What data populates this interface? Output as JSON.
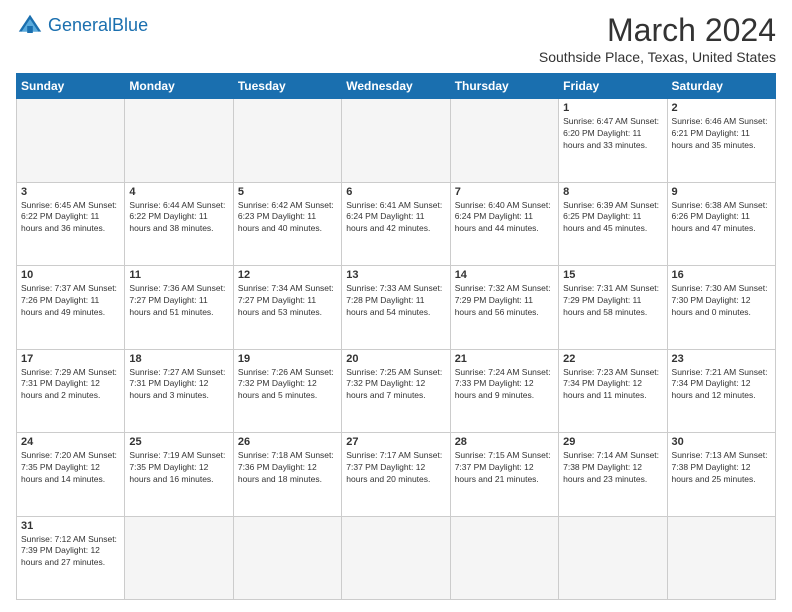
{
  "header": {
    "logo_general": "General",
    "logo_blue": "Blue",
    "month_title": "March 2024",
    "subtitle": "Southside Place, Texas, United States"
  },
  "days_of_week": [
    "Sunday",
    "Monday",
    "Tuesday",
    "Wednesday",
    "Thursday",
    "Friday",
    "Saturday"
  ],
  "weeks": [
    [
      {
        "day": "",
        "empty": true
      },
      {
        "day": "",
        "empty": true
      },
      {
        "day": "",
        "empty": true
      },
      {
        "day": "",
        "empty": true
      },
      {
        "day": "",
        "empty": true
      },
      {
        "day": "1",
        "info": "Sunrise: 6:47 AM\nSunset: 6:20 PM\nDaylight: 11 hours\nand 33 minutes."
      },
      {
        "day": "2",
        "info": "Sunrise: 6:46 AM\nSunset: 6:21 PM\nDaylight: 11 hours\nand 35 minutes."
      }
    ],
    [
      {
        "day": "3",
        "info": "Sunrise: 6:45 AM\nSunset: 6:22 PM\nDaylight: 11 hours\nand 36 minutes."
      },
      {
        "day": "4",
        "info": "Sunrise: 6:44 AM\nSunset: 6:22 PM\nDaylight: 11 hours\nand 38 minutes."
      },
      {
        "day": "5",
        "info": "Sunrise: 6:42 AM\nSunset: 6:23 PM\nDaylight: 11 hours\nand 40 minutes."
      },
      {
        "day": "6",
        "info": "Sunrise: 6:41 AM\nSunset: 6:24 PM\nDaylight: 11 hours\nand 42 minutes."
      },
      {
        "day": "7",
        "info": "Sunrise: 6:40 AM\nSunset: 6:24 PM\nDaylight: 11 hours\nand 44 minutes."
      },
      {
        "day": "8",
        "info": "Sunrise: 6:39 AM\nSunset: 6:25 PM\nDaylight: 11 hours\nand 45 minutes."
      },
      {
        "day": "9",
        "info": "Sunrise: 6:38 AM\nSunset: 6:26 PM\nDaylight: 11 hours\nand 47 minutes."
      }
    ],
    [
      {
        "day": "10",
        "info": "Sunrise: 7:37 AM\nSunset: 7:26 PM\nDaylight: 11 hours\nand 49 minutes."
      },
      {
        "day": "11",
        "info": "Sunrise: 7:36 AM\nSunset: 7:27 PM\nDaylight: 11 hours\nand 51 minutes."
      },
      {
        "day": "12",
        "info": "Sunrise: 7:34 AM\nSunset: 7:27 PM\nDaylight: 11 hours\nand 53 minutes."
      },
      {
        "day": "13",
        "info": "Sunrise: 7:33 AM\nSunset: 7:28 PM\nDaylight: 11 hours\nand 54 minutes."
      },
      {
        "day": "14",
        "info": "Sunrise: 7:32 AM\nSunset: 7:29 PM\nDaylight: 11 hours\nand 56 minutes."
      },
      {
        "day": "15",
        "info": "Sunrise: 7:31 AM\nSunset: 7:29 PM\nDaylight: 11 hours\nand 58 minutes."
      },
      {
        "day": "16",
        "info": "Sunrise: 7:30 AM\nSunset: 7:30 PM\nDaylight: 12 hours\nand 0 minutes."
      }
    ],
    [
      {
        "day": "17",
        "info": "Sunrise: 7:29 AM\nSunset: 7:31 PM\nDaylight: 12 hours\nand 2 minutes."
      },
      {
        "day": "18",
        "info": "Sunrise: 7:27 AM\nSunset: 7:31 PM\nDaylight: 12 hours\nand 3 minutes."
      },
      {
        "day": "19",
        "info": "Sunrise: 7:26 AM\nSunset: 7:32 PM\nDaylight: 12 hours\nand 5 minutes."
      },
      {
        "day": "20",
        "info": "Sunrise: 7:25 AM\nSunset: 7:32 PM\nDaylight: 12 hours\nand 7 minutes."
      },
      {
        "day": "21",
        "info": "Sunrise: 7:24 AM\nSunset: 7:33 PM\nDaylight: 12 hours\nand 9 minutes."
      },
      {
        "day": "22",
        "info": "Sunrise: 7:23 AM\nSunset: 7:34 PM\nDaylight: 12 hours\nand 11 minutes."
      },
      {
        "day": "23",
        "info": "Sunrise: 7:21 AM\nSunset: 7:34 PM\nDaylight: 12 hours\nand 12 minutes."
      }
    ],
    [
      {
        "day": "24",
        "info": "Sunrise: 7:20 AM\nSunset: 7:35 PM\nDaylight: 12 hours\nand 14 minutes."
      },
      {
        "day": "25",
        "info": "Sunrise: 7:19 AM\nSunset: 7:35 PM\nDaylight: 12 hours\nand 16 minutes."
      },
      {
        "day": "26",
        "info": "Sunrise: 7:18 AM\nSunset: 7:36 PM\nDaylight: 12 hours\nand 18 minutes."
      },
      {
        "day": "27",
        "info": "Sunrise: 7:17 AM\nSunset: 7:37 PM\nDaylight: 12 hours\nand 20 minutes."
      },
      {
        "day": "28",
        "info": "Sunrise: 7:15 AM\nSunset: 7:37 PM\nDaylight: 12 hours\nand 21 minutes."
      },
      {
        "day": "29",
        "info": "Sunrise: 7:14 AM\nSunset: 7:38 PM\nDaylight: 12 hours\nand 23 minutes."
      },
      {
        "day": "30",
        "info": "Sunrise: 7:13 AM\nSunset: 7:38 PM\nDaylight: 12 hours\nand 25 minutes."
      }
    ],
    [
      {
        "day": "31",
        "info": "Sunrise: 7:12 AM\nSunset: 7:39 PM\nDaylight: 12 hours\nand 27 minutes."
      },
      {
        "day": "",
        "empty": true
      },
      {
        "day": "",
        "empty": true
      },
      {
        "day": "",
        "empty": true
      },
      {
        "day": "",
        "empty": true
      },
      {
        "day": "",
        "empty": true
      },
      {
        "day": "",
        "empty": true
      }
    ]
  ]
}
